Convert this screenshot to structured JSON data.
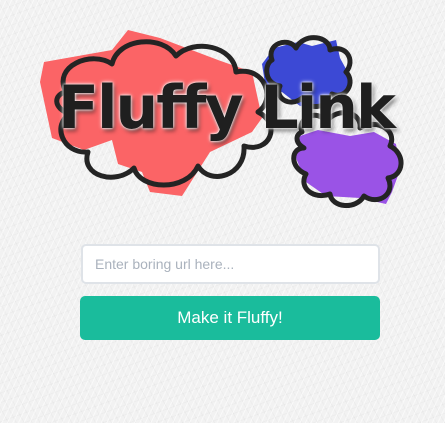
{
  "logo": {
    "title": "Fluffy Link",
    "colors": {
      "red_splash": "#fb6466",
      "blue_splash": "#3c49d5",
      "purple_splash": "#9a53e6",
      "cloud_outline": "#242424",
      "title_text": "#1f1f1f"
    }
  },
  "form": {
    "url_placeholder": "Enter boring url here...",
    "url_value": "",
    "submit_label": "Make it Fluffy!",
    "submit_color": "#1abc9c",
    "submit_text_color": "#ffffff"
  }
}
